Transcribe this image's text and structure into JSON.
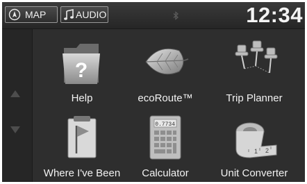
{
  "status_bar": {
    "map_label": "MAP",
    "audio_label": "AUDIO",
    "clock": "12:34"
  },
  "apps": [
    {
      "label": "Help",
      "icon": "help-folder-icon"
    },
    {
      "label": "ecoRoute™",
      "icon": "eco-leaf-icon"
    },
    {
      "label": "Trip Planner",
      "icon": "push-pins-icon"
    },
    {
      "label": "Where I've Been",
      "icon": "flag-clipboard-icon"
    },
    {
      "label": "Calculator",
      "icon": "calculator-icon"
    },
    {
      "label": "Unit Converter",
      "icon": "tape-measure-icon"
    }
  ],
  "calculator_display": "0.7734",
  "colors": {
    "background": "#2e2e2e",
    "text": "#f2f2f2"
  }
}
